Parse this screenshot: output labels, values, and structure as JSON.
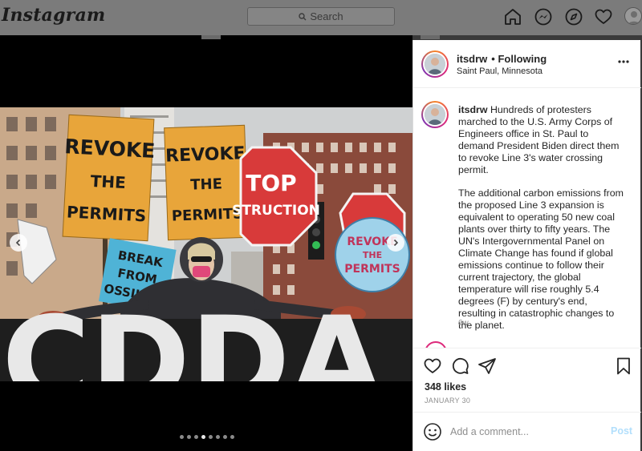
{
  "nav": {
    "logo": "Instagram",
    "search_placeholder": "Search",
    "icons": [
      "home-icon",
      "messenger-icon",
      "explore-icon",
      "heart-icon",
      "profile-avatar"
    ]
  },
  "post": {
    "username": "itsdrw",
    "separator": "•",
    "follow_status": "Following",
    "location": "Saint Paul, Minnesota",
    "caption_p1": "Hundreds of protesters marched to the U.S. Army Corps of Engineers office in St. Paul to demand President Biden direct them to revoke Line 3's water crossing permit.",
    "caption_p2": "The additional carbon emissions from the proposed Line 3 expansion is equivalent to operating 50 new coal plants over thirty to fifty years. The UN's Intergovernmental Panel on Climate Change has found if global emissions continue to follow their current trajectory, the global temperature will rise roughly 5.4 degrees (F) by century's end, resulting in catastrophic changes to the planet.",
    "caption_time": "6w",
    "likes": "348 likes",
    "date": "JANUARY 30",
    "comment_placeholder": "Add a comment...",
    "post_label": "Post",
    "carousel": {
      "count": 8,
      "active_index": 3
    }
  },
  "photo_signs": {
    "sign1": [
      "REVOKE",
      "THE",
      "PERMITS"
    ],
    "sign2": [
      "REVOKE",
      "THE",
      "PERMITS"
    ],
    "stop_sign": [
      "TOP",
      "STRUCTION"
    ],
    "blue_sign": [
      "BREAK",
      "FROM",
      "OSSIL FU"
    ],
    "round_sign": [
      "REVOKE",
      "THE",
      "PERMITS"
    ],
    "banner": "CDDA"
  },
  "colors": {
    "accent_blue": "#0095f6",
    "post_disabled": "#b2dffc",
    "sign_orange": "#e8a53a",
    "stop_red": "#d83a3a",
    "blue_sign": "#4fb3d6"
  }
}
